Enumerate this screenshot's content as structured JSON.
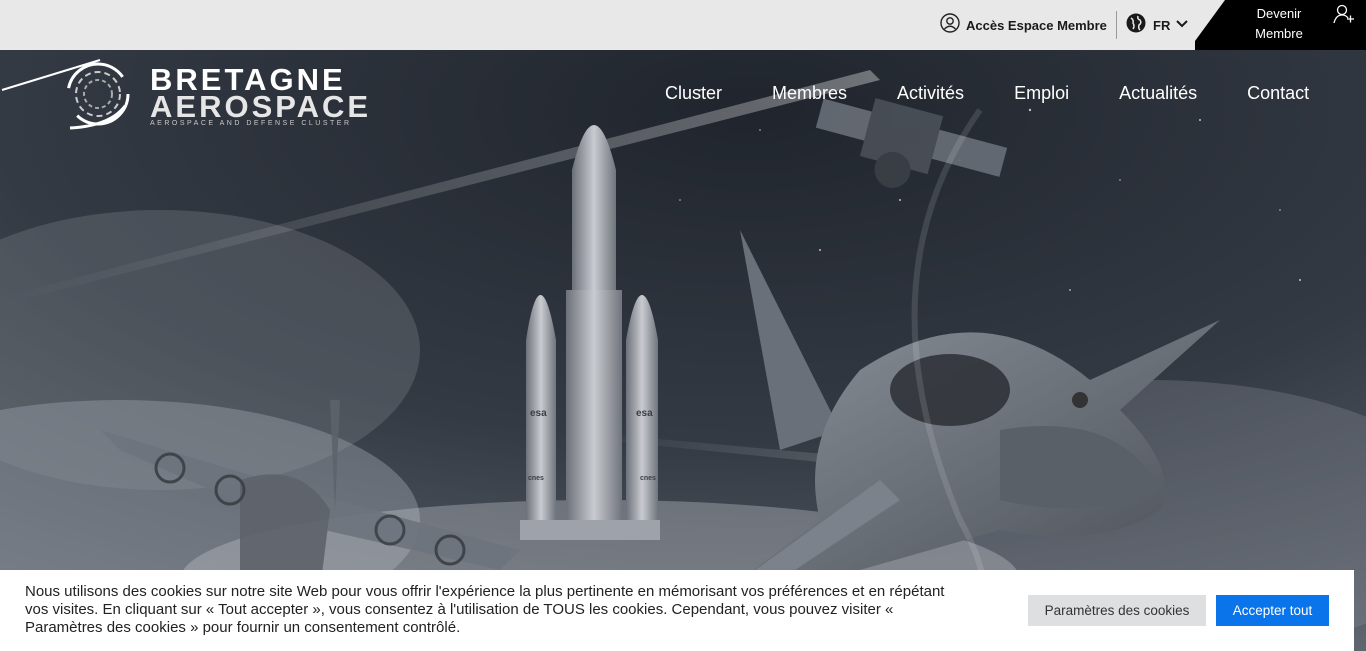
{
  "topbar": {
    "member_access_label": "Accès Espace Membre",
    "member_access_icon": "user-circle-icon",
    "language": "FR",
    "language_icon": "globe-icon",
    "become_member_label": "Devenir Membre",
    "become_member_icon": "add-user-icon"
  },
  "logo": {
    "line1": "BRETAGNE",
    "line2": "AEROSPACE",
    "tagline": "AEROSPACE AND DEFENSE CLUSTER"
  },
  "nav": {
    "items": [
      {
        "label": "Cluster"
      },
      {
        "label": "Membres"
      },
      {
        "label": "Activités"
      },
      {
        "label": "Emploi"
      },
      {
        "label": "Actualités"
      },
      {
        "label": "Contact"
      }
    ]
  },
  "hero": {
    "rocket_labels": [
      "esa",
      "esa",
      "cnes",
      "cnes"
    ]
  },
  "cookie": {
    "message": "Nous utilisons des cookies sur notre site Web pour vous offrir l'expérience la plus pertinente en mémorisant vos préférences et en répétant vos visites. En cliquant sur « Tout accepter », vous consentez à l'utilisation de TOUS les cookies. Cependant, vous pouvez visiter « Paramètres des cookies » pour fournir un consentement contrôlé.",
    "settings_label": "Paramètres des cookies",
    "accept_label": "Accepter tout"
  },
  "colors": {
    "topbar_bg": "#e8e8e8",
    "become_member_bg": "#000000",
    "accept_button": "#0a74ea"
  }
}
